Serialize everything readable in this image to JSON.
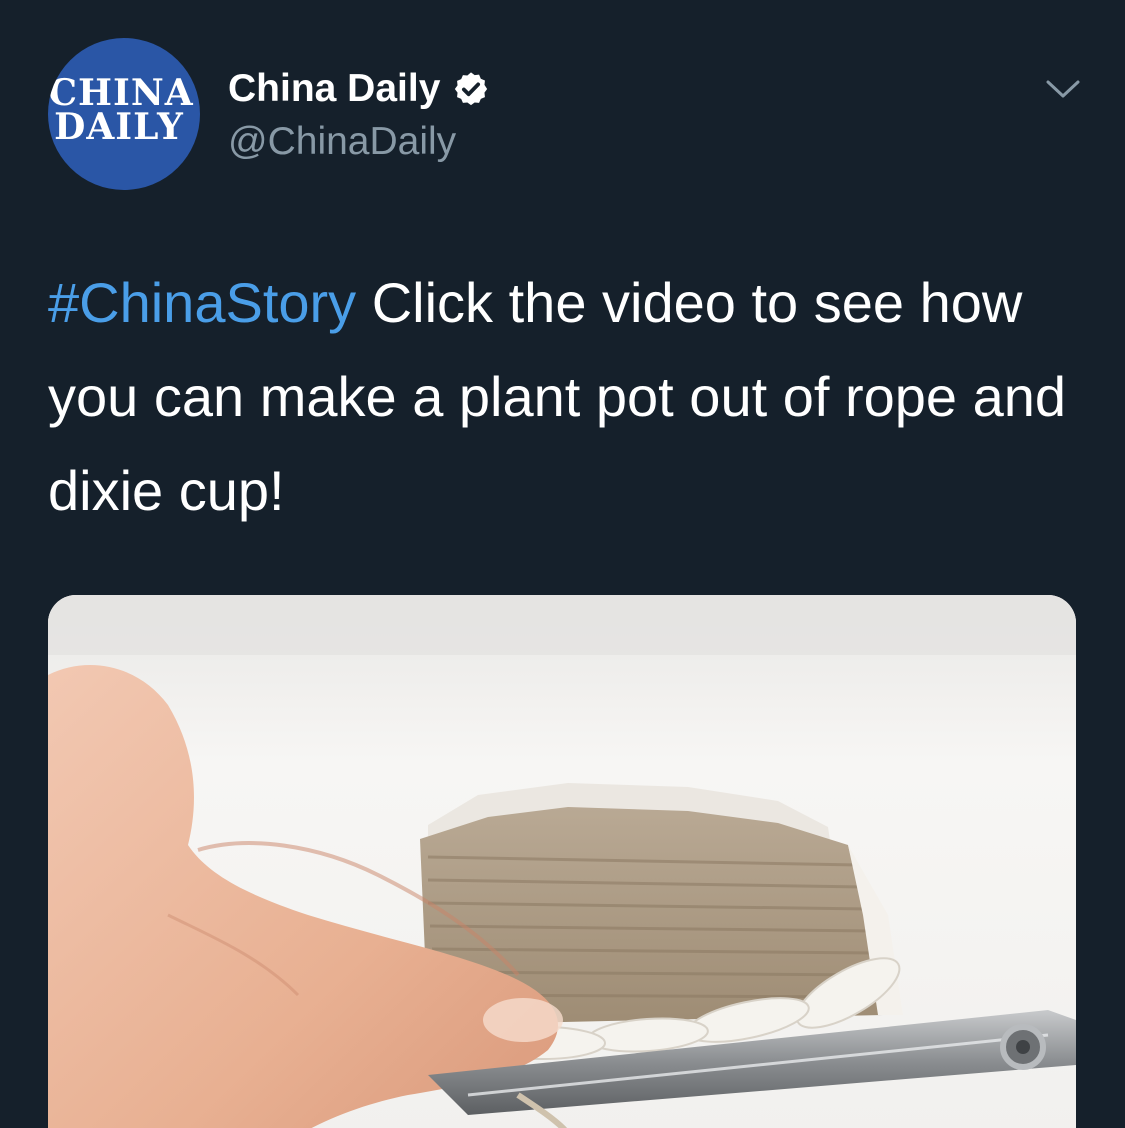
{
  "author": {
    "display_name": "China Daily",
    "handle": "@ChinaDaily",
    "verified": true,
    "avatar_line1": "CHINA",
    "avatar_line2": "DAILY"
  },
  "tweet": {
    "hashtag": "#ChinaStory",
    "text": " Click the video to see how you can make a plant pot out of rope and dixie cup!"
  },
  "icons": {
    "verified": "verified-badge-icon",
    "menu": "chevron-down-icon"
  },
  "colors": {
    "background": "#15202b",
    "hashtag": "#4a9ee8",
    "secondary_text": "#8899a6",
    "avatar_bg": "#2a56a6"
  },
  "media": {
    "kind": "video-thumbnail",
    "content": "hand cutting rope-wrapped paper cup with scissors"
  }
}
